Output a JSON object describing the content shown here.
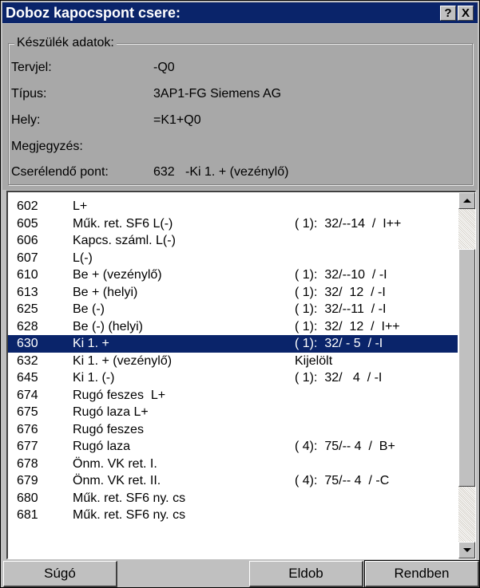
{
  "window": {
    "title": "Doboz kapocspont csere:",
    "help_btn": "?",
    "close_btn": "X"
  },
  "device": {
    "legend": "Készülék adatok:",
    "fields": [
      {
        "label": "Tervjel:",
        "value": "-Q0"
      },
      {
        "label": "Típus:",
        "value": "3AP1-FG Siemens AG"
      },
      {
        "label": "Hely:",
        "value": "=K1+Q0"
      },
      {
        "label": "Megjegyzés:",
        "value": ""
      },
      {
        "label": "Cserélendő pont:",
        "value": "632   -Ki 1. + (vezénylő)"
      }
    ]
  },
  "list": {
    "rows": [
      {
        "code": "602",
        "name": "L+",
        "ref": ""
      },
      {
        "code": "605",
        "name": "Műk. ret. SF6 L(-)",
        "ref": "( 1):  32/--14  /  I++"
      },
      {
        "code": "606",
        "name": "Kapcs. száml. L(-)",
        "ref": ""
      },
      {
        "code": "607",
        "name": "L(-)",
        "ref": ""
      },
      {
        "code": "610",
        "name": "Be + (vezénylő)",
        "ref": "( 1):  32/--10  / -I"
      },
      {
        "code": "613",
        "name": "Be + (helyi)",
        "ref": "( 1):  32/  12  / -I"
      },
      {
        "code": "625",
        "name": "Be (-)",
        "ref": "( 1):  32/--11  / -I"
      },
      {
        "code": "628",
        "name": "Be (-) (helyi)",
        "ref": "( 1):  32/  12  /  I++"
      },
      {
        "code": "630",
        "name": "Ki 1. +",
        "ref": "( 1):  32/ - 5  / -I"
      },
      {
        "code": "632",
        "name": "Ki 1. + (vezénylő)",
        "ref": "Kijelölt"
      },
      {
        "code": "645",
        "name": "Ki 1. (-)",
        "ref": "( 1):  32/   4  / -I"
      },
      {
        "code": "674",
        "name": "Rugó feszes  L+",
        "ref": ""
      },
      {
        "code": "675",
        "name": "Rugó laza L+",
        "ref": ""
      },
      {
        "code": "676",
        "name": "Rugó feszes",
        "ref": ""
      },
      {
        "code": "677",
        "name": "Rugó laza",
        "ref": "( 4):  75/-- 4  /  B+"
      },
      {
        "code": "678",
        "name": "Önm. VK ret. I.",
        "ref": ""
      },
      {
        "code": "679",
        "name": "Önm. VK ret. II.",
        "ref": "( 4):  75/-- 4  / -C"
      },
      {
        "code": "680",
        "name": "Műk. ret. SF6 ny. cs",
        "ref": ""
      },
      {
        "code": "681",
        "name": "Műk. ret. SF6 ny. cs",
        "ref": ""
      }
    ],
    "selected_code": "630"
  },
  "buttons": {
    "help": "Súgó",
    "discard": "Eldob",
    "ok": "Rendben"
  },
  "colors": {
    "title_bg": "#0a246a",
    "selection_bg": "#0a246a",
    "info_bg": "#a8a8a8",
    "face": "#c0c0c0"
  }
}
